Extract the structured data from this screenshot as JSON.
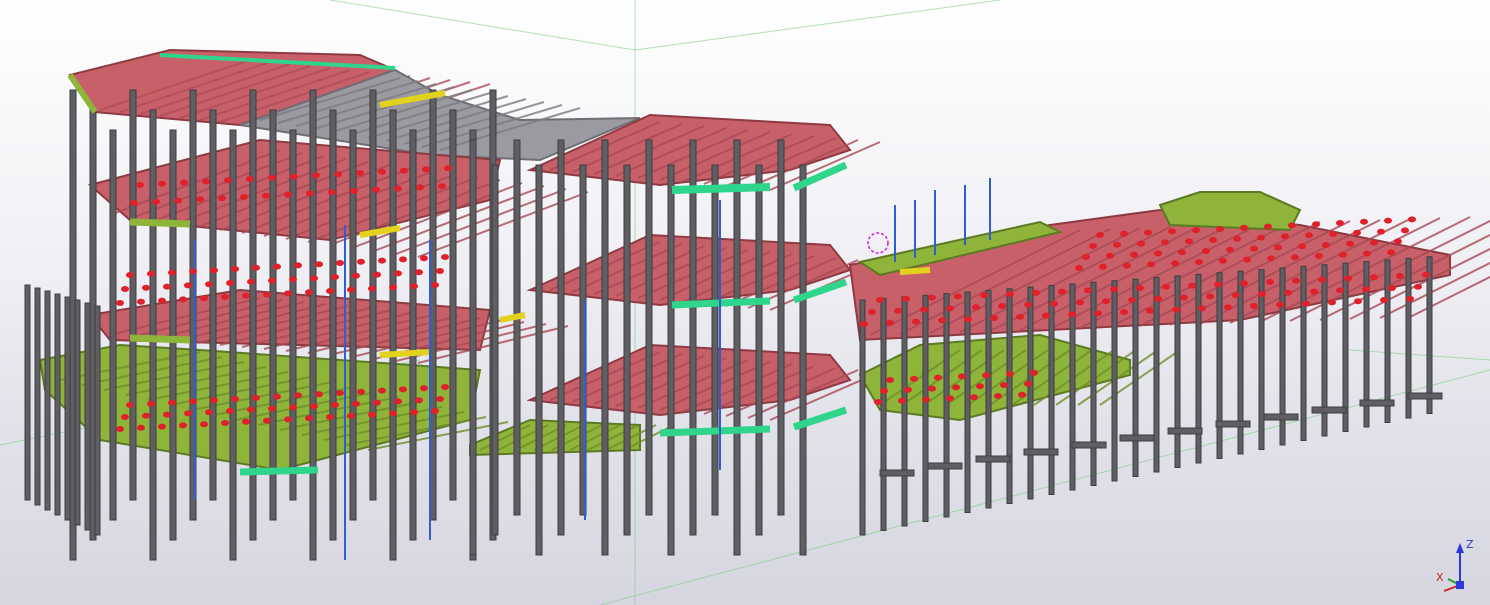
{
  "viewport": {
    "view_type": "3d-model-view",
    "background_top": "#ffffff",
    "background_bottom": "#d6d6e0"
  },
  "colors": {
    "column": "#5f5f63",
    "column_edge": "#3d3d40",
    "slab_red": "#c8606a",
    "slab_red_edge": "#8e3a42",
    "slab_green": "#8fb43a",
    "slab_green_edge": "#5c7a22",
    "slab_grey": "#9a9aa0",
    "beam_cyan": "#2ed58a",
    "beam_yellow": "#e3d21d",
    "blue_member": "#2e5fd0",
    "red_marker": "#e0202a",
    "magenta_marker": "#d020d0",
    "guide_green": "#7ccf7c"
  },
  "axis_triad": {
    "z_label": "Z",
    "x_label": "X",
    "z_color": "#2a3ad8",
    "x_color": "#d02020",
    "y_color": "#20a020"
  }
}
